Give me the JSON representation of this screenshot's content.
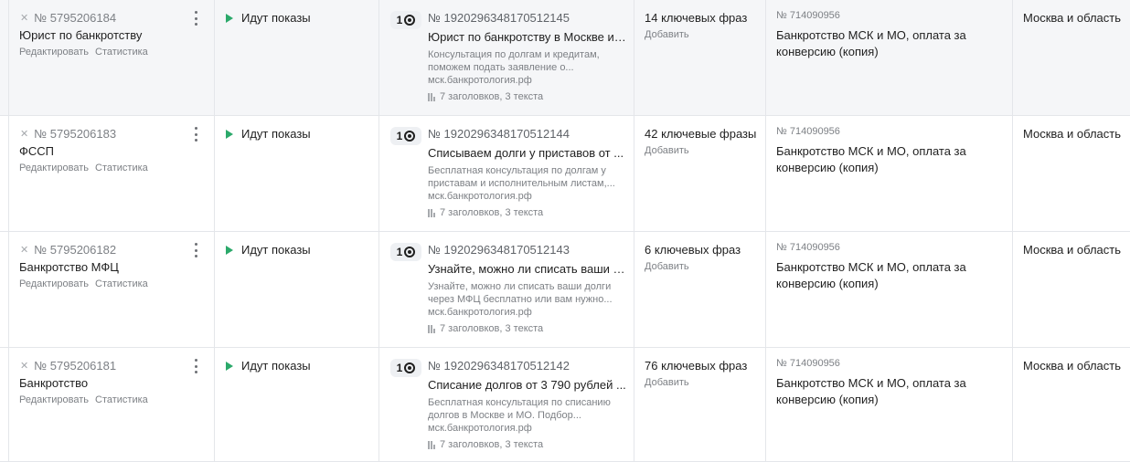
{
  "rows": [
    {
      "group_id": "№ 5795206184",
      "group_name": "Юрист по банкротству",
      "edit_label": "Редактировать",
      "stats_label": "Статистика",
      "status": "Идут показы",
      "badge_count": "1",
      "ad_id": "№ 1920296348170512145",
      "ad_title": "Юрист по банкротству в Москве и ...",
      "ad_desc": "Консультация по долгам и кредитам, поможем подать заявление о...",
      "ad_url": "мск.банкротология.рф",
      "ad_meta": "7 заголовков, 3 текста",
      "keywords": "14 ключевых фраз",
      "kw_add": "Добавить",
      "campaign_id": "№ 714090956",
      "campaign_name": "Банкротство МСК и МО, оплата за конверсию (копия)",
      "region": "Москва и область"
    },
    {
      "group_id": "№ 5795206183",
      "group_name": "ФССП",
      "edit_label": "Редактировать",
      "stats_label": "Статистика",
      "status": "Идут показы",
      "badge_count": "1",
      "ad_id": "№ 1920296348170512144",
      "ad_title": "Списываем долги у приставов от ...",
      "ad_desc": "Бесплатная консультация по долгам у приставам и исполнительным листам,...",
      "ad_url": "мск.банкротология.рф",
      "ad_meta": "7 заголовков, 3 текста",
      "keywords": "42 ключевые фразы",
      "kw_add": "Добавить",
      "campaign_id": "№ 714090956",
      "campaign_name": "Банкротство МСК и МО, оплата за конверсию (копия)",
      "region": "Москва и область"
    },
    {
      "group_id": "№ 5795206182",
      "group_name": "Банкротство МФЦ",
      "edit_label": "Редактировать",
      "stats_label": "Статистика",
      "status": "Идут показы",
      "badge_count": "1",
      "ad_id": "№ 1920296348170512143",
      "ad_title": "Узнайте, можно ли списать ваши д...",
      "ad_desc": "Узнайте, можно ли списать ваши долги через МФЦ бесплатно или вам нужно...",
      "ad_url": "мск.банкротология.рф",
      "ad_meta": "7 заголовков, 3 текста",
      "keywords": "6 ключевых фраз",
      "kw_add": "Добавить",
      "campaign_id": "№ 714090956",
      "campaign_name": "Банкротство МСК и МО, оплата за конверсию (копия)",
      "region": "Москва и область"
    },
    {
      "group_id": "№ 5795206181",
      "group_name": "Банкротство",
      "edit_label": "Редактировать",
      "stats_label": "Статистика",
      "status": "Идут показы",
      "badge_count": "1",
      "ad_id": "№ 1920296348170512142",
      "ad_title": "Списание долгов от 3 790 рублей ...",
      "ad_desc": "Бесплатная консультация по списанию долгов в Москве и МО. Подбор...",
      "ad_url": "мск.банкротология.рф",
      "ad_meta": "7 заголовков, 3 текста",
      "keywords": "76 ключевых фраз",
      "kw_add": "Добавить",
      "campaign_id": "№ 714090956",
      "campaign_name": "Банкротство МСК и МО, оплата за конверсию (копия)",
      "region": "Москва и область"
    }
  ]
}
